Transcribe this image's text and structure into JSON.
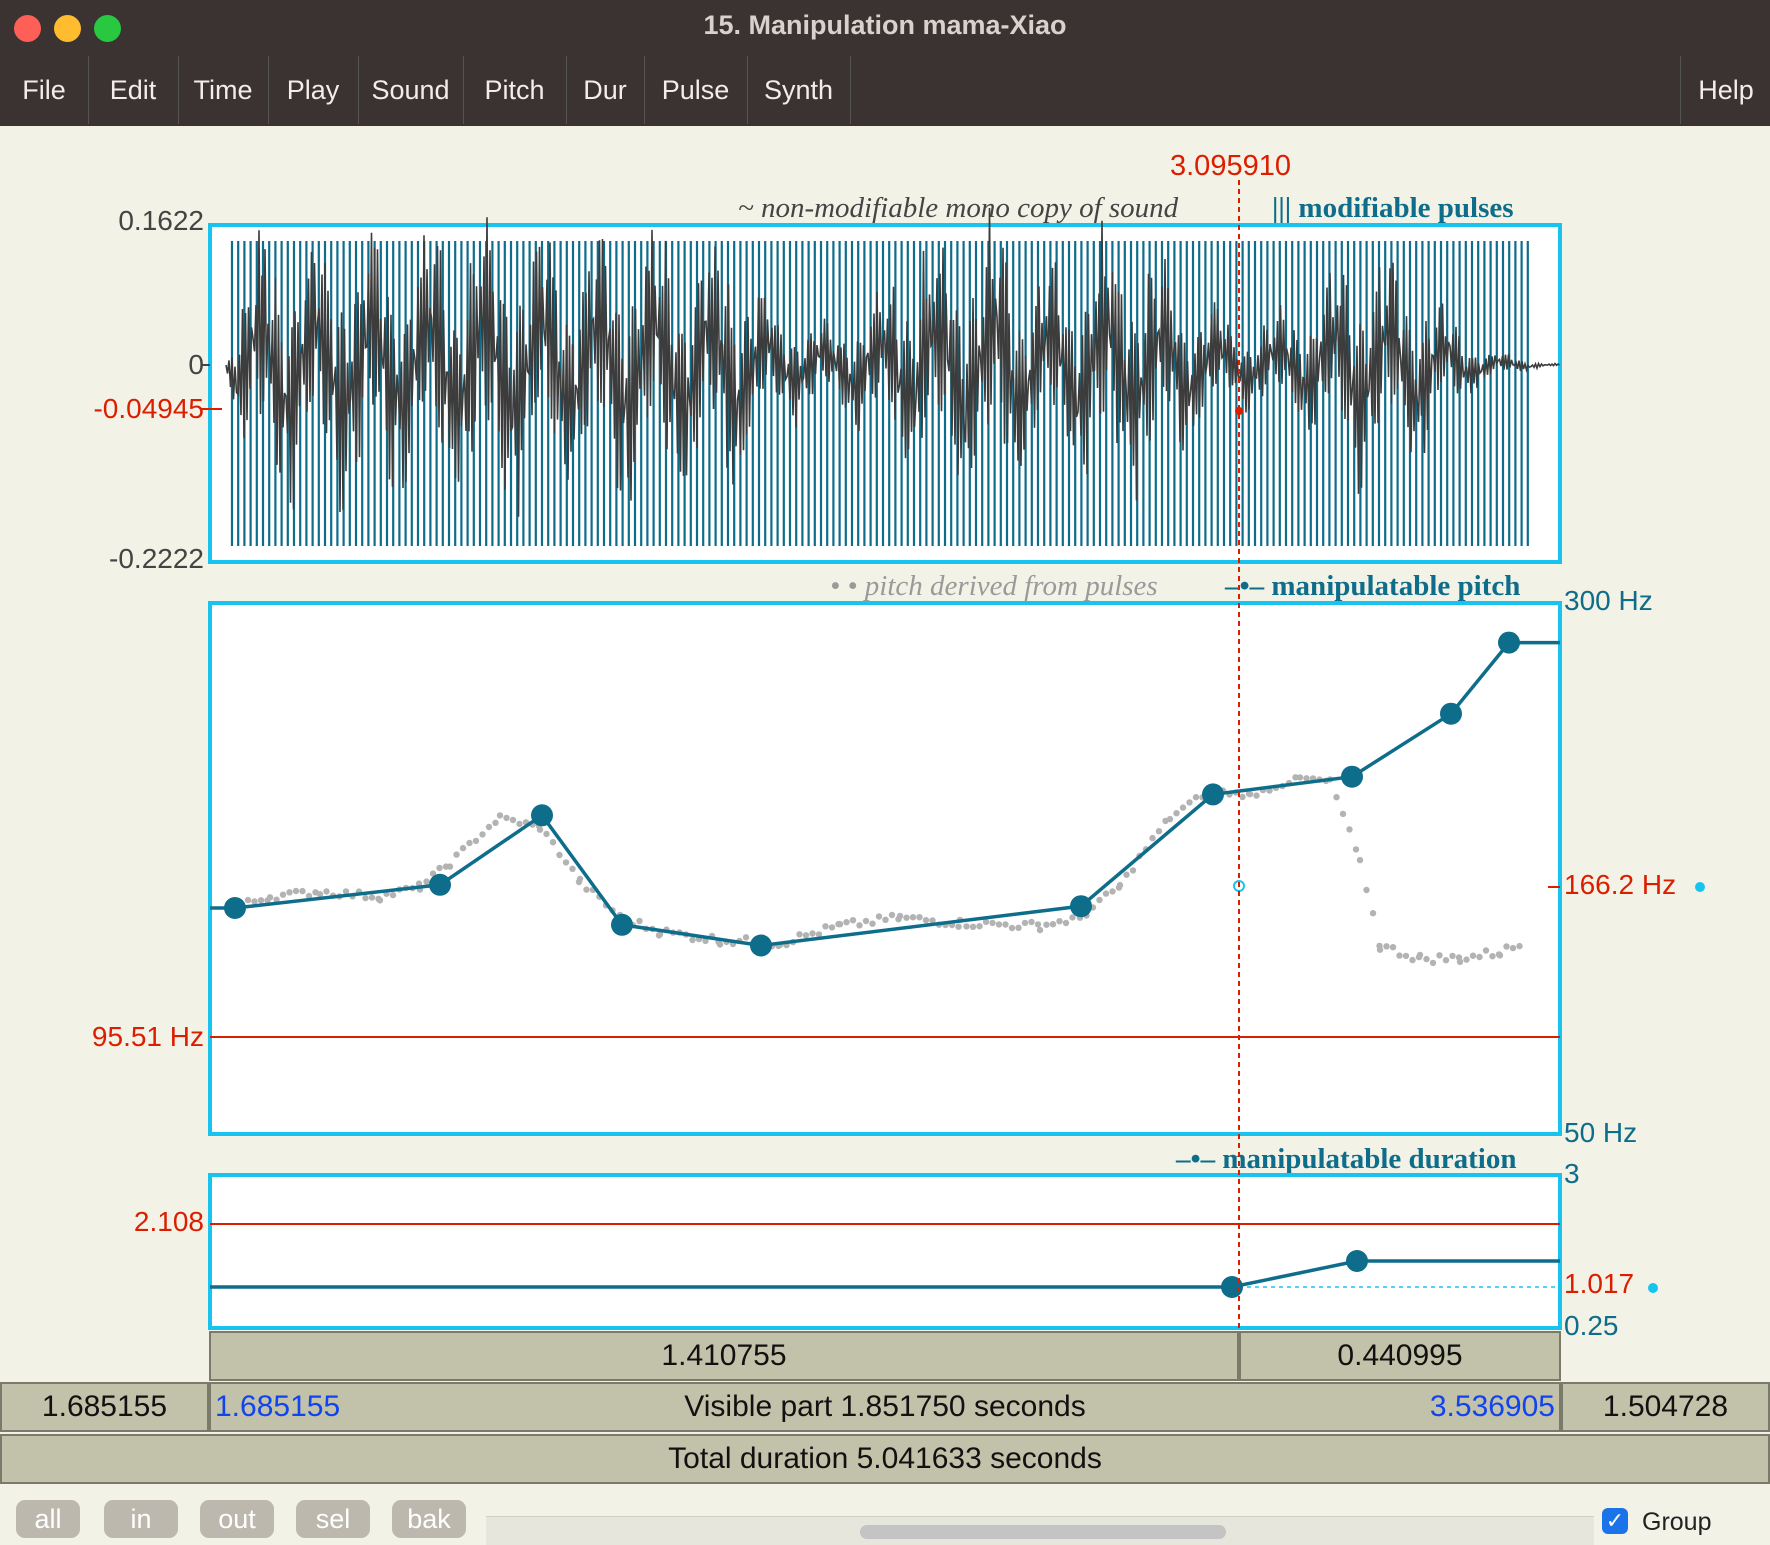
{
  "window": {
    "title": "15. Manipulation mama-Xiao"
  },
  "menu": [
    {
      "label": "File"
    },
    {
      "label": "Edit"
    },
    {
      "label": "Time"
    },
    {
      "label": "Play"
    },
    {
      "label": "Sound"
    },
    {
      "label": "Pitch"
    },
    {
      "label": "Dur"
    },
    {
      "label": "Pulse"
    },
    {
      "label": "Synth"
    },
    {
      "label": "Help"
    }
  ],
  "cursor": {
    "time": "3.095910"
  },
  "sound_pane": {
    "max": "0.1622",
    "zero": "0",
    "cursor_value": "-0.04945",
    "min": "-0.2222",
    "legend_copy": "~ non-modifiable mono copy of sound",
    "legend_pulses": "||| modifiable pulses"
  },
  "pitch_pane": {
    "legend_derived": "• • pitch derived from pulses",
    "legend_manip": "–•– manipulatable pitch",
    "top_label": "300 Hz",
    "bottom_label": "50 Hz",
    "cursor_value": "166.2 Hz",
    "hline_value": "95.51 Hz",
    "points_hz": [
      109.6,
      118.8,
      151.2,
      103.4,
      96.2,
      110.3,
      162.6,
      172.9,
      215.2,
      275.4
    ]
  },
  "duration_pane": {
    "legend": "–•– manipulatable duration",
    "top_label": "3",
    "bottom_label": "0.25",
    "cursor_value": "1.017",
    "hline_value": "2.108",
    "points": [
      1.0,
      1.2
    ]
  },
  "selection": {
    "left": "1.410755",
    "right": "0.440995"
  },
  "visible_row": {
    "before": "1.685155",
    "start": "1.685155",
    "label": "Visible part 1.851750 seconds",
    "end": "3.536905",
    "after": "1.504728"
  },
  "total_row": {
    "label": "Total duration 5.041633 seconds"
  },
  "buttons": [
    {
      "label": "all"
    },
    {
      "label": "in"
    },
    {
      "label": "out"
    },
    {
      "label": "sel"
    },
    {
      "label": "bak"
    }
  ],
  "group": {
    "label": "Group",
    "checked": true
  },
  "colors": {
    "teal": "#0e6d8a",
    "frame": "#19c3f0",
    "red": "#dc1e00",
    "wave": "#3c3c3c"
  }
}
